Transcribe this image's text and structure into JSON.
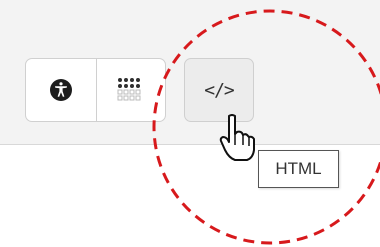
{
  "toolbar": {
    "accessibility_icon": "accessibility-icon",
    "blocks_icon": "blocks-grid-icon",
    "html_button_label": "</>"
  },
  "tooltip": {
    "text": "HTML"
  },
  "cursor_icon": "hand-pointer-icon",
  "highlight": {
    "color": "#d7191c",
    "style": "dashed-circle"
  },
  "colors": {
    "toolbar_background": "#f3f3f3",
    "button_background": "#ffffff",
    "active_button_background": "#ececec"
  }
}
